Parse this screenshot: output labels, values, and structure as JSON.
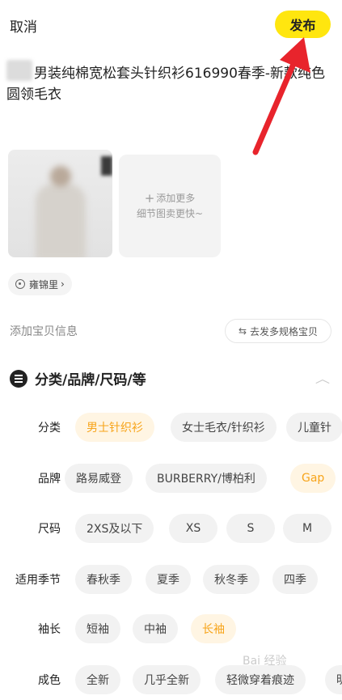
{
  "header": {
    "cancel_label": "取消",
    "publish_label": "发布"
  },
  "listing": {
    "title": "男装纯棉宽松套头针织衫616990春季-新款纯色圆领毛衣"
  },
  "photos": {
    "add_more_line1": "添加更多",
    "add_more_line2": "细节图卖更快~"
  },
  "location": {
    "label": "雍锦里"
  },
  "info": {
    "add_info_label": "添加宝贝信息",
    "spec_button_label": "去发多规格宝贝"
  },
  "category_section": {
    "title": "分类/品牌/尺码/等"
  },
  "attributes": [
    {
      "label": "分类",
      "options": [
        {
          "text": "男士针织衫",
          "selected": true
        },
        {
          "text": "女士毛衣/针织衫",
          "selected": false
        },
        {
          "text": "儿童针",
          "selected": false
        }
      ]
    },
    {
      "label": "品牌",
      "options": [
        {
          "text": "路易威登",
          "selected": false
        },
        {
          "text": "BURBERRY/博柏利",
          "selected": false
        },
        {
          "text": "Gap",
          "selected": true
        }
      ]
    },
    {
      "label": "尺码",
      "options": [
        {
          "text": "2XS及以下",
          "selected": false
        },
        {
          "text": "XS",
          "selected": false
        },
        {
          "text": "S",
          "selected": false
        },
        {
          "text": "M",
          "selected": false
        }
      ]
    },
    {
      "label": "适用季节",
      "options": [
        {
          "text": "春秋季",
          "selected": false
        },
        {
          "text": "夏季",
          "selected": false
        },
        {
          "text": "秋冬季",
          "selected": false
        },
        {
          "text": "四季",
          "selected": false
        }
      ]
    },
    {
      "label": "袖长",
      "options": [
        {
          "text": "短袖",
          "selected": false
        },
        {
          "text": "中袖",
          "selected": false
        },
        {
          "text": "长袖",
          "selected": true
        }
      ]
    },
    {
      "label": "成色",
      "options": [
        {
          "text": "全新",
          "selected": false
        },
        {
          "text": "几乎全新",
          "selected": false
        },
        {
          "text": "轻微穿着痕迹",
          "selected": false
        },
        {
          "text": "明",
          "selected": false
        }
      ]
    }
  ],
  "colors": {
    "accent_yellow": "#ffe60f",
    "selected_text": "#f7a41a",
    "annotation_red": "#e8242c"
  },
  "icons": [
    "location-pin-icon",
    "swap-icon",
    "category-list-icon",
    "chevron-up-icon",
    "plus-icon"
  ]
}
